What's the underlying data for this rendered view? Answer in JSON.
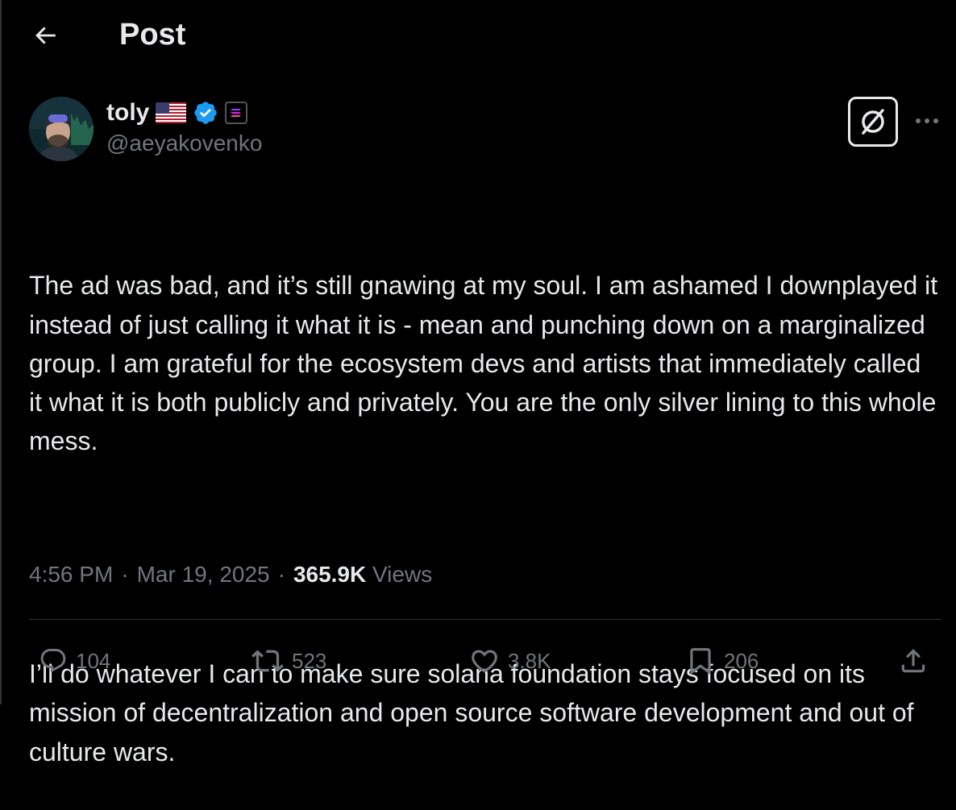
{
  "header": {
    "title": "Post"
  },
  "author": {
    "display_name": "toly",
    "handle": "@aeyakovenko",
    "flag": "🇺🇸"
  },
  "post": {
    "paragraphs": [
      "The ad was bad, and it’s still gnawing at my soul. I am ashamed I downplayed it instead of just calling it what it is - mean and punching down on a marginalized group. I am grateful for the ecosystem devs and artists that immediately called it what it is both publicly and privately. You are the only silver lining to this whole mess.",
      "I’ll do whatever I can to make sure solana foundation stays focused on its mission of decentralization and open source software development and out of culture wars."
    ],
    "time": "4:56 PM",
    "sep1": "·",
    "date": "Mar 19, 2025",
    "sep2": "·",
    "views_count": "365.9K",
    "views_label": "Views"
  },
  "actions": {
    "replies": "104",
    "reposts": "523",
    "likes": "3.8K",
    "bookmarks": "206"
  },
  "icons": {
    "back": "arrow-left-icon",
    "grok": "grok-icon",
    "more": "more-horizontal-icon",
    "reply": "reply-icon",
    "repost": "repost-icon",
    "like": "heart-icon",
    "bookmark": "bookmark-icon",
    "share": "share-icon",
    "verified": "verified-badge-icon",
    "affiliate": "solana-affiliate-icon"
  },
  "colors": {
    "background": "#000000",
    "text": "#e7e9ea",
    "muted": "#71767b",
    "verified": "#1d9bf0",
    "divider": "#2f3336"
  }
}
